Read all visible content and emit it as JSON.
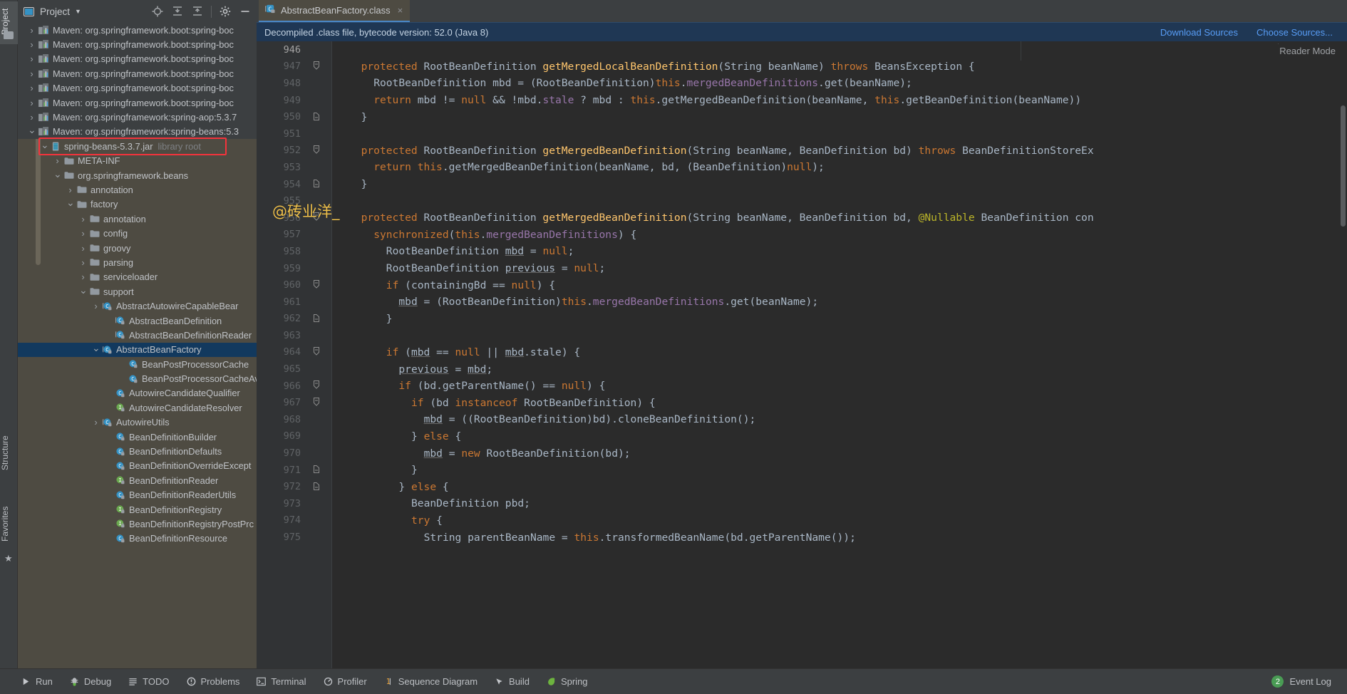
{
  "window": {
    "vertical_tabs": [
      {
        "label": "Project",
        "name": "tool-window-project"
      },
      {
        "label": "Structure",
        "name": "tool-window-structure"
      },
      {
        "label": "Favorites",
        "name": "tool-window-favorites"
      }
    ]
  },
  "project_panel": {
    "title": "Project",
    "actions": [
      {
        "name": "locate-icon",
        "glyph": "⊕"
      },
      {
        "name": "expand-all-icon",
        "glyph": "≡"
      },
      {
        "name": "collapse-all-icon",
        "glyph": "≡"
      },
      {
        "name": "settings-gear-icon",
        "glyph": "⚙"
      },
      {
        "name": "hide-panel-icon",
        "glyph": "—"
      }
    ]
  },
  "tree": {
    "items": [
      {
        "label": "Maven: org.springframework.boot:spring-boc",
        "icon": "maven-icon",
        "arrow": "collapsed",
        "indent": 0,
        "style": "dark"
      },
      {
        "label": "Maven: org.springframework.boot:spring-boc",
        "icon": "maven-icon",
        "arrow": "collapsed",
        "indent": 0,
        "style": "dark"
      },
      {
        "label": "Maven: org.springframework.boot:spring-boc",
        "icon": "maven-icon",
        "arrow": "collapsed",
        "indent": 0,
        "style": "dark"
      },
      {
        "label": "Maven: org.springframework.boot:spring-boc",
        "icon": "maven-icon",
        "arrow": "collapsed",
        "indent": 0,
        "style": "dark"
      },
      {
        "label": "Maven: org.springframework.boot:spring-boc",
        "icon": "maven-icon",
        "arrow": "collapsed",
        "indent": 0,
        "style": "dark"
      },
      {
        "label": "Maven: org.springframework.boot:spring-boc",
        "icon": "maven-icon",
        "arrow": "collapsed",
        "indent": 0,
        "style": "dark"
      },
      {
        "label": "Maven: org.springframework:spring-aop:5.3.7",
        "icon": "maven-icon",
        "arrow": "collapsed",
        "indent": 0,
        "style": "dark"
      },
      {
        "label": "Maven: org.springframework:spring-beans:5.3",
        "icon": "maven-icon",
        "arrow": "expanded",
        "indent": 0,
        "style": "dark"
      },
      {
        "label": "spring-beans-5.3.7.jar",
        "dim": "library root",
        "icon": "jar-icon",
        "arrow": "expanded",
        "indent": 1,
        "style": "normal",
        "highlighted": true
      },
      {
        "label": "META-INF",
        "icon": "folder-icon",
        "arrow": "collapsed",
        "indent": 2,
        "style": "normal"
      },
      {
        "label": "org.springframework.beans",
        "icon": "folder-icon",
        "arrow": "expanded",
        "indent": 2,
        "style": "normal"
      },
      {
        "label": "annotation",
        "icon": "folder-icon",
        "arrow": "collapsed",
        "indent": 3,
        "style": "normal"
      },
      {
        "label": "factory",
        "icon": "folder-icon",
        "arrow": "expanded",
        "indent": 3,
        "style": "normal"
      },
      {
        "label": "annotation",
        "icon": "folder-icon",
        "arrow": "collapsed",
        "indent": 4,
        "style": "normal"
      },
      {
        "label": "config",
        "icon": "folder-icon",
        "arrow": "collapsed",
        "indent": 4,
        "style": "normal"
      },
      {
        "label": "groovy",
        "icon": "folder-icon",
        "arrow": "collapsed",
        "indent": 4,
        "style": "normal"
      },
      {
        "label": "parsing",
        "icon": "folder-icon",
        "arrow": "collapsed",
        "indent": 4,
        "style": "normal"
      },
      {
        "label": "serviceloader",
        "icon": "folder-icon",
        "arrow": "collapsed",
        "indent": 4,
        "style": "normal"
      },
      {
        "label": "support",
        "icon": "folder-icon",
        "arrow": "expanded",
        "indent": 4,
        "style": "normal"
      },
      {
        "label": "AbstractAutowireCapableBear",
        "icon": "abstract-class-icon",
        "arrow": "collapsed",
        "indent": 5,
        "style": "normal"
      },
      {
        "label": "AbstractBeanDefinition",
        "icon": "abstract-class-icon",
        "arrow": "none",
        "indent": 6,
        "style": "normal"
      },
      {
        "label": "AbstractBeanDefinitionReader",
        "icon": "abstract-class-icon",
        "arrow": "none",
        "indent": 6,
        "style": "normal"
      },
      {
        "label": "AbstractBeanFactory",
        "icon": "abstract-class-icon",
        "arrow": "expanded",
        "indent": 5,
        "style": "selected"
      },
      {
        "label": "BeanPostProcessorCache",
        "icon": "class-icon",
        "arrow": "none",
        "indent": 7,
        "style": "normal"
      },
      {
        "label": "BeanPostProcessorCacheAv",
        "icon": "class-icon",
        "arrow": "none",
        "indent": 7,
        "style": "normal"
      },
      {
        "label": "AutowireCandidateQualifier",
        "icon": "class-icon",
        "arrow": "none",
        "indent": 6,
        "style": "normal"
      },
      {
        "label": "AutowireCandidateResolver",
        "icon": "interface-icon",
        "arrow": "none",
        "indent": 6,
        "style": "normal"
      },
      {
        "label": "AutowireUtils",
        "icon": "abstract-class-icon",
        "arrow": "collapsed",
        "indent": 5,
        "style": "normal"
      },
      {
        "label": "BeanDefinitionBuilder",
        "icon": "class-icon",
        "arrow": "none",
        "indent": 6,
        "style": "normal"
      },
      {
        "label": "BeanDefinitionDefaults",
        "icon": "class-icon",
        "arrow": "none",
        "indent": 6,
        "style": "normal"
      },
      {
        "label": "BeanDefinitionOverrideExcept",
        "icon": "class-icon",
        "arrow": "none",
        "indent": 6,
        "style": "normal"
      },
      {
        "label": "BeanDefinitionReader",
        "icon": "interface-icon",
        "arrow": "none",
        "indent": 6,
        "style": "normal"
      },
      {
        "label": "BeanDefinitionReaderUtils",
        "icon": "class-icon",
        "arrow": "none",
        "indent": 6,
        "style": "normal"
      },
      {
        "label": "BeanDefinitionRegistry",
        "icon": "interface-icon",
        "arrow": "none",
        "indent": 6,
        "style": "normal"
      },
      {
        "label": "BeanDefinitionRegistryPostPrc",
        "icon": "interface-icon",
        "arrow": "none",
        "indent": 6,
        "style": "normal"
      },
      {
        "label": "BeanDefinitionResource",
        "icon": "class-icon",
        "arrow": "none",
        "indent": 6,
        "style": "normal"
      }
    ]
  },
  "editor_tab": {
    "label": "AbstractBeanFactory.class",
    "close_glyph": "×"
  },
  "notification": {
    "message": "Decompiled .class file, bytecode version: 52.0 (Java 8)",
    "download_sources": "Download Sources",
    "choose_sources": "Choose Sources..."
  },
  "reader_mode": "Reader Mode",
  "watermark": "@砖业洋_",
  "code": {
    "first_line": 946,
    "lines": [
      {
        "n": 946,
        "fold": "",
        "indent": 0,
        "tokens": []
      },
      {
        "n": 947,
        "fold": "minus",
        "indent": 1,
        "tokens": [
          {
            "t": "protected ",
            "c": "kw"
          },
          {
            "t": "RootBeanDefinition ",
            "c": ""
          },
          {
            "t": "getMergedLocalBeanDefinition",
            "c": "mth"
          },
          {
            "t": "(String beanName) ",
            "c": ""
          },
          {
            "t": "throws ",
            "c": "kw"
          },
          {
            "t": "BeansException {",
            "c": ""
          }
        ]
      },
      {
        "n": 948,
        "fold": "",
        "indent": 2,
        "tokens": [
          {
            "t": "RootBeanDefinition mbd = (RootBeanDefinition)",
            "c": ""
          },
          {
            "t": "this",
            "c": "kw"
          },
          {
            "t": ".",
            "c": ""
          },
          {
            "t": "mergedBeanDefinitions",
            "c": "fld"
          },
          {
            "t": ".get(beanName);",
            "c": ""
          }
        ]
      },
      {
        "n": 949,
        "fold": "",
        "indent": 2,
        "tokens": [
          {
            "t": "return ",
            "c": "kw"
          },
          {
            "t": "mbd != ",
            "c": ""
          },
          {
            "t": "null ",
            "c": "kw"
          },
          {
            "t": "&& !mbd.",
            "c": ""
          },
          {
            "t": "stale",
            "c": "fld"
          },
          {
            "t": " ? mbd : ",
            "c": ""
          },
          {
            "t": "this",
            "c": "kw"
          },
          {
            "t": ".getMergedBeanDefinition(beanName, ",
            "c": ""
          },
          {
            "t": "this",
            "c": "kw"
          },
          {
            "t": ".getBeanDefinition(beanName))",
            "c": ""
          }
        ]
      },
      {
        "n": 950,
        "fold": "end",
        "indent": 1,
        "tokens": [
          {
            "t": "}",
            "c": ""
          }
        ]
      },
      {
        "n": 951,
        "fold": "",
        "indent": 0,
        "tokens": []
      },
      {
        "n": 952,
        "fold": "minus",
        "indent": 1,
        "tokens": [
          {
            "t": "protected ",
            "c": "kw"
          },
          {
            "t": "RootBeanDefinition ",
            "c": ""
          },
          {
            "t": "getMergedBeanDefinition",
            "c": "mth"
          },
          {
            "t": "(String beanName, BeanDefinition bd) ",
            "c": ""
          },
          {
            "t": "throws ",
            "c": "kw"
          },
          {
            "t": "BeanDefinitionStoreEx",
            "c": ""
          }
        ]
      },
      {
        "n": 953,
        "fold": "",
        "indent": 2,
        "tokens": [
          {
            "t": "return ",
            "c": "kw"
          },
          {
            "t": "this",
            "c": "kw"
          },
          {
            "t": ".getMergedBeanDefinition(beanName, bd, (BeanDefinition)",
            "c": ""
          },
          {
            "t": "null",
            "c": "kw"
          },
          {
            "t": ");",
            "c": ""
          }
        ]
      },
      {
        "n": 954,
        "fold": "end",
        "indent": 1,
        "tokens": [
          {
            "t": "}",
            "c": ""
          }
        ]
      },
      {
        "n": 955,
        "fold": "",
        "indent": 0,
        "tokens": []
      },
      {
        "n": 956,
        "fold": "minus",
        "indent": 1,
        "tokens": [
          {
            "t": "protected ",
            "c": "kw"
          },
          {
            "t": "RootBeanDefinition ",
            "c": ""
          },
          {
            "t": "getMergedBeanDefinition",
            "c": "mth"
          },
          {
            "t": "(String beanName, BeanDefinition bd, ",
            "c": ""
          },
          {
            "t": "@Nullable ",
            "c": "ann"
          },
          {
            "t": "BeanDefinition con",
            "c": ""
          }
        ]
      },
      {
        "n": 957,
        "fold": "",
        "indent": 2,
        "tokens": [
          {
            "t": "synchronized",
            "c": "kw"
          },
          {
            "t": "(",
            "c": ""
          },
          {
            "t": "this",
            "c": "kw"
          },
          {
            "t": ".",
            "c": ""
          },
          {
            "t": "mergedBeanDefinitions",
            "c": "fld"
          },
          {
            "t": ") {",
            "c": ""
          }
        ]
      },
      {
        "n": 958,
        "fold": "",
        "indent": 3,
        "tokens": [
          {
            "t": "RootBeanDefinition ",
            "c": ""
          },
          {
            "t": "mbd",
            "c": "u"
          },
          {
            "t": " = ",
            "c": ""
          },
          {
            "t": "null",
            "c": "kw"
          },
          {
            "t": ";",
            "c": ""
          }
        ]
      },
      {
        "n": 959,
        "fold": "",
        "indent": 3,
        "tokens": [
          {
            "t": "RootBeanDefinition ",
            "c": ""
          },
          {
            "t": "previous",
            "c": "u"
          },
          {
            "t": " = ",
            "c": ""
          },
          {
            "t": "null",
            "c": "kw"
          },
          {
            "t": ";",
            "c": ""
          }
        ]
      },
      {
        "n": 960,
        "fold": "minus",
        "indent": 3,
        "tokens": [
          {
            "t": "if ",
            "c": "kw"
          },
          {
            "t": "(containingBd == ",
            "c": ""
          },
          {
            "t": "null",
            "c": "kw"
          },
          {
            "t": ") {",
            "c": ""
          }
        ]
      },
      {
        "n": 961,
        "fold": "",
        "indent": 4,
        "tokens": [
          {
            "t": "mbd",
            "c": "u"
          },
          {
            "t": " = (RootBeanDefinition)",
            "c": ""
          },
          {
            "t": "this",
            "c": "kw"
          },
          {
            "t": ".",
            "c": ""
          },
          {
            "t": "mergedBeanDefinitions",
            "c": "fld"
          },
          {
            "t": ".get(beanName);",
            "c": ""
          }
        ]
      },
      {
        "n": 962,
        "fold": "end",
        "indent": 3,
        "tokens": [
          {
            "t": "}",
            "c": ""
          }
        ]
      },
      {
        "n": 963,
        "fold": "",
        "indent": 0,
        "tokens": []
      },
      {
        "n": 964,
        "fold": "minus",
        "indent": 3,
        "tokens": [
          {
            "t": "if ",
            "c": "kw"
          },
          {
            "t": "(",
            "c": ""
          },
          {
            "t": "mbd",
            "c": "u"
          },
          {
            "t": " == ",
            "c": ""
          },
          {
            "t": "null ",
            "c": "kw"
          },
          {
            "t": "|| ",
            "c": ""
          },
          {
            "t": "mbd",
            "c": "u"
          },
          {
            "t": ".stale) {",
            "c": ""
          }
        ]
      },
      {
        "n": 965,
        "fold": "",
        "indent": 4,
        "tokens": [
          {
            "t": "previous",
            "c": "u"
          },
          {
            "t": " = ",
            "c": ""
          },
          {
            "t": "mbd",
            "c": "u"
          },
          {
            "t": ";",
            "c": ""
          }
        ]
      },
      {
        "n": 966,
        "fold": "minus",
        "indent": 4,
        "tokens": [
          {
            "t": "if ",
            "c": "kw"
          },
          {
            "t": "(bd.getParentName() == ",
            "c": ""
          },
          {
            "t": "null",
            "c": "kw"
          },
          {
            "t": ") {",
            "c": ""
          }
        ]
      },
      {
        "n": 967,
        "fold": "minus",
        "indent": 5,
        "tokens": [
          {
            "t": "if ",
            "c": "kw"
          },
          {
            "t": "(bd ",
            "c": ""
          },
          {
            "t": "instanceof ",
            "c": "kw"
          },
          {
            "t": "RootBeanDefinition) {",
            "c": ""
          }
        ]
      },
      {
        "n": 968,
        "fold": "",
        "indent": 6,
        "tokens": [
          {
            "t": "mbd",
            "c": "u"
          },
          {
            "t": " = ((RootBeanDefinition)bd).cloneBeanDefinition();",
            "c": ""
          }
        ]
      },
      {
        "n": 969,
        "fold": "",
        "indent": 5,
        "tokens": [
          {
            "t": "} ",
            "c": ""
          },
          {
            "t": "else ",
            "c": "kw"
          },
          {
            "t": "{",
            "c": ""
          }
        ]
      },
      {
        "n": 970,
        "fold": "",
        "indent": 6,
        "tokens": [
          {
            "t": "mbd",
            "c": "u"
          },
          {
            "t": " = ",
            "c": ""
          },
          {
            "t": "new ",
            "c": "kw"
          },
          {
            "t": "RootBeanDefinition(bd);",
            "c": ""
          }
        ]
      },
      {
        "n": 971,
        "fold": "end",
        "indent": 5,
        "tokens": [
          {
            "t": "}",
            "c": ""
          }
        ]
      },
      {
        "n": 972,
        "fold": "end",
        "indent": 4,
        "tokens": [
          {
            "t": "} ",
            "c": ""
          },
          {
            "t": "else ",
            "c": "kw"
          },
          {
            "t": "{",
            "c": ""
          }
        ]
      },
      {
        "n": 973,
        "fold": "",
        "indent": 5,
        "tokens": [
          {
            "t": "BeanDefinition pbd;",
            "c": ""
          }
        ]
      },
      {
        "n": 974,
        "fold": "",
        "indent": 5,
        "tokens": [
          {
            "t": "try ",
            "c": "kw"
          },
          {
            "t": "{",
            "c": ""
          }
        ]
      },
      {
        "n": 975,
        "fold": "",
        "indent": 6,
        "tokens": [
          {
            "t": "String parentBeanName = ",
            "c": ""
          },
          {
            "t": "this",
            "c": "kw"
          },
          {
            "t": ".transformedBeanName(bd.getParentName());",
            "c": ""
          }
        ]
      }
    ]
  },
  "statusbar": {
    "items": [
      {
        "label": "Run",
        "icon": "run-icon"
      },
      {
        "label": "Debug",
        "icon": "debug-icon"
      },
      {
        "label": "TODO",
        "icon": "todo-icon"
      },
      {
        "label": "Problems",
        "icon": "problems-icon"
      },
      {
        "label": "Terminal",
        "icon": "terminal-icon"
      },
      {
        "label": "Profiler",
        "icon": "profiler-icon"
      },
      {
        "label": "Sequence Diagram",
        "icon": "sequence-diagram-icon"
      },
      {
        "label": "Build",
        "icon": "build-icon"
      },
      {
        "label": "Spring",
        "icon": "spring-icon"
      }
    ],
    "event_log": {
      "label": "Event Log",
      "count": "2"
    }
  },
  "colors": {
    "accent": "#4a88c7",
    "notification_bg": "#1f3754",
    "link": "#589df6",
    "selection": "#12395e",
    "highlight_box": "#f4333c",
    "watermark": "#f0c14b",
    "editor_bg": "#2b2b2b",
    "panel_bg": "#4e4b42"
  }
}
